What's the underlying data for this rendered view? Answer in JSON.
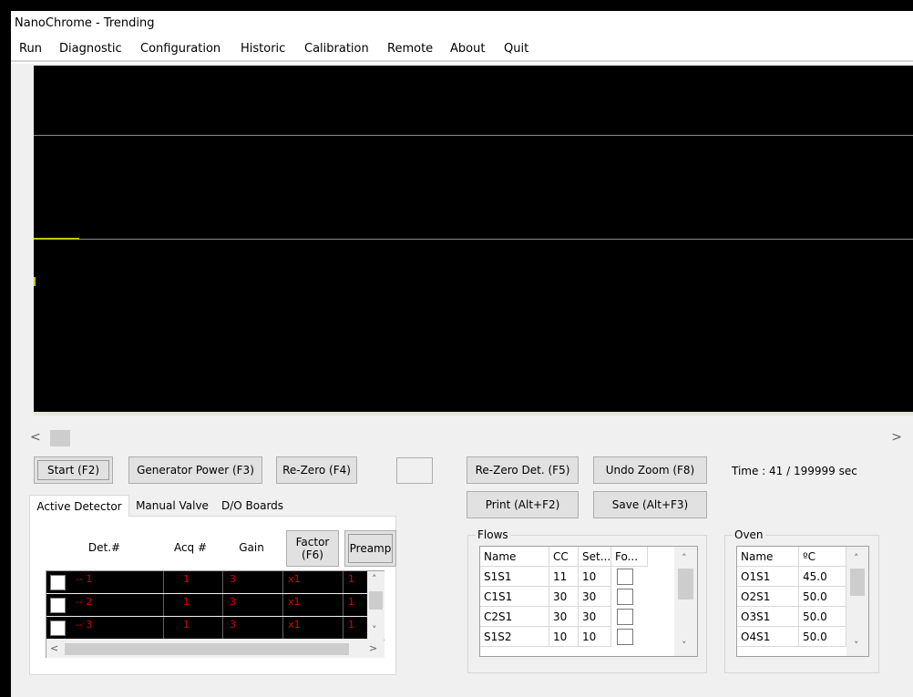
{
  "window": {
    "title": "NanoChrome - Trending"
  },
  "menu": [
    "Run",
    "Diagnostic",
    "Configuration",
    "Historic",
    "Calibration",
    "Remote",
    "About",
    "Quit"
  ],
  "colors": {
    "plot_background": "#000000",
    "trace": "#c8c800",
    "detector_text": "#e00000"
  },
  "scrollbar": {
    "left_arrow": "<",
    "right_arrow": ">"
  },
  "buttons": {
    "start": "Start (F2)",
    "generator_power": "Generator Power (F3)",
    "rezero": "Re-Zero (F4)",
    "rezero_det": "Re-Zero Det. (F5)",
    "undo_zoom": "Undo Zoom (F8)",
    "print": "Print (Alt+F2)",
    "save": "Save (Alt+F3)"
  },
  "time": {
    "label": "Time : 41 / 199999 sec"
  },
  "tabs": [
    "Active Detector",
    "Manual Valve",
    "D/O Boards"
  ],
  "detector": {
    "headers": {
      "det": "Det.#",
      "acq": "Acq #",
      "gain": "Gain"
    },
    "factor_button": [
      "Factor",
      "(F6)"
    ],
    "preamp_button": "Preamp",
    "rows": [
      {
        "det": "-- 1",
        "acq": "1",
        "gain": "3",
        "factor": "x1",
        "preamp": "1"
      },
      {
        "det": "-- 2",
        "acq": "1",
        "gain": "3",
        "factor": "x1",
        "preamp": "1"
      },
      {
        "det": "-- 3",
        "acq": "1",
        "gain": "3",
        "factor": "x1",
        "preamp": "1"
      }
    ]
  },
  "flows": {
    "title": "Flows",
    "headers": [
      "Name",
      "CC",
      "Set...",
      "Fo..."
    ],
    "rows": [
      {
        "name": "S1S1",
        "cc": "11",
        "set": "10"
      },
      {
        "name": "C1S1",
        "cc": "30",
        "set": "30"
      },
      {
        "name": "C2S1",
        "cc": "30",
        "set": "30"
      },
      {
        "name": "S1S2",
        "cc": "10",
        "set": "10"
      }
    ]
  },
  "oven": {
    "title": "Oven",
    "headers": [
      "Name",
      "ºC"
    ],
    "rows": [
      {
        "name": "O1S1",
        "temp": "45.0"
      },
      {
        "name": "O2S1",
        "temp": "50.0"
      },
      {
        "name": "O3S1",
        "temp": "50.0"
      },
      {
        "name": "O4S1",
        "temp": "50.0"
      }
    ]
  }
}
